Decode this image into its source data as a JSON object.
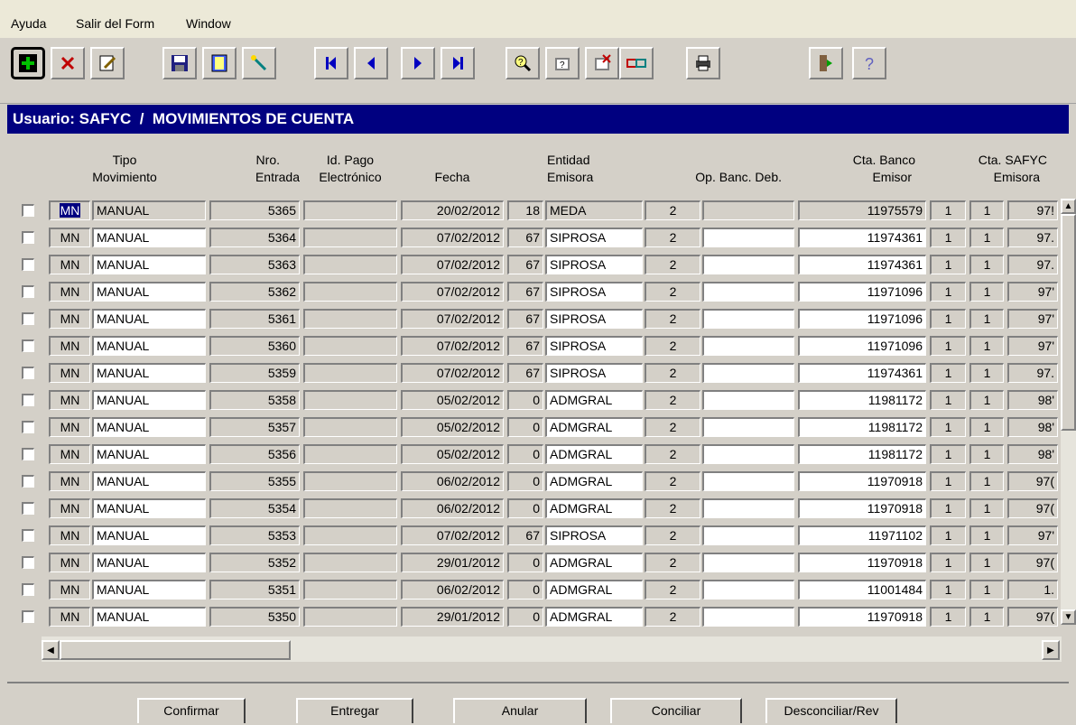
{
  "menu": {
    "items": [
      "Ayuda",
      "Salir del Form",
      "Window"
    ]
  },
  "toolbar": {
    "buttons": [
      "add-record-icon",
      "delete-record-icon",
      "edit-record-icon",
      "save-icon",
      "open-book-icon",
      "wand-icon",
      "first-record-icon",
      "previous-record-icon",
      "next-record-icon",
      "last-record-icon",
      "query-icon",
      "execute-query-icon",
      "cancel-query-icon",
      "link-icon",
      "print-icon",
      "exit-door-icon",
      "help-icon"
    ]
  },
  "header": {
    "title": "Usuario: SAFYC  /  MOVIMIENTOS DE CUENTA"
  },
  "columns": {
    "tipo": [
      "Tipo",
      "Movimiento"
    ],
    "nro": [
      "Nro.",
      "Entrada"
    ],
    "idpago": [
      "Id. Pago",
      "Electrónico"
    ],
    "fecha": "Fecha",
    "entidad": [
      "Entidad",
      "Emisora"
    ],
    "opbanc": "Op. Banc. Deb.",
    "ctabanco": [
      "Cta. Banco",
      "Emisor"
    ],
    "ctasafyc": [
      "Cta. SAFYC",
      "Emisora"
    ]
  },
  "rows": [
    {
      "code": "MN",
      "type": "MANUAL",
      "nro": "5365",
      "id_pago": "",
      "fecha": "20/02/2012",
      "ent_code": "18",
      "entidad": "MEDA",
      "op": "2",
      "op_deb": "",
      "cta_banco": "11975579",
      "s1": "1",
      "s2": "1",
      "s3": "97!"
    },
    {
      "code": "MN",
      "type": "MANUAL",
      "nro": "5364",
      "id_pago": "",
      "fecha": "07/02/2012",
      "ent_code": "67",
      "entidad": "SIPROSA",
      "op": "2",
      "op_deb": "",
      "cta_banco": "11974361",
      "s1": "1",
      "s2": "1",
      "s3": "97."
    },
    {
      "code": "MN",
      "type": "MANUAL",
      "nro": "5363",
      "id_pago": "",
      "fecha": "07/02/2012",
      "ent_code": "67",
      "entidad": "SIPROSA",
      "op": "2",
      "op_deb": "",
      "cta_banco": "11974361",
      "s1": "1",
      "s2": "1",
      "s3": "97."
    },
    {
      "code": "MN",
      "type": "MANUAL",
      "nro": "5362",
      "id_pago": "",
      "fecha": "07/02/2012",
      "ent_code": "67",
      "entidad": "SIPROSA",
      "op": "2",
      "op_deb": "",
      "cta_banco": "11971096",
      "s1": "1",
      "s2": "1",
      "s3": "97'"
    },
    {
      "code": "MN",
      "type": "MANUAL",
      "nro": "5361",
      "id_pago": "",
      "fecha": "07/02/2012",
      "ent_code": "67",
      "entidad": "SIPROSA",
      "op": "2",
      "op_deb": "",
      "cta_banco": "11971096",
      "s1": "1",
      "s2": "1",
      "s3": "97'"
    },
    {
      "code": "MN",
      "type": "MANUAL",
      "nro": "5360",
      "id_pago": "",
      "fecha": "07/02/2012",
      "ent_code": "67",
      "entidad": "SIPROSA",
      "op": "2",
      "op_deb": "",
      "cta_banco": "11971096",
      "s1": "1",
      "s2": "1",
      "s3": "97'"
    },
    {
      "code": "MN",
      "type": "MANUAL",
      "nro": "5359",
      "id_pago": "",
      "fecha": "07/02/2012",
      "ent_code": "67",
      "entidad": "SIPROSA",
      "op": "2",
      "op_deb": "",
      "cta_banco": "11974361",
      "s1": "1",
      "s2": "1",
      "s3": "97."
    },
    {
      "code": "MN",
      "type": "MANUAL",
      "nro": "5358",
      "id_pago": "",
      "fecha": "05/02/2012",
      "ent_code": "0",
      "entidad": "ADMGRAL",
      "op": "2",
      "op_deb": "",
      "cta_banco": "11981172",
      "s1": "1",
      "s2": "1",
      "s3": "98'"
    },
    {
      "code": "MN",
      "type": "MANUAL",
      "nro": "5357",
      "id_pago": "",
      "fecha": "05/02/2012",
      "ent_code": "0",
      "entidad": "ADMGRAL",
      "op": "2",
      "op_deb": "",
      "cta_banco": "11981172",
      "s1": "1",
      "s2": "1",
      "s3": "98'"
    },
    {
      "code": "MN",
      "type": "MANUAL",
      "nro": "5356",
      "id_pago": "",
      "fecha": "05/02/2012",
      "ent_code": "0",
      "entidad": "ADMGRAL",
      "op": "2",
      "op_deb": "",
      "cta_banco": "11981172",
      "s1": "1",
      "s2": "1",
      "s3": "98'"
    },
    {
      "code": "MN",
      "type": "MANUAL",
      "nro": "5355",
      "id_pago": "",
      "fecha": "06/02/2012",
      "ent_code": "0",
      "entidad": "ADMGRAL",
      "op": "2",
      "op_deb": "",
      "cta_banco": "11970918",
      "s1": "1",
      "s2": "1",
      "s3": "97("
    },
    {
      "code": "MN",
      "type": "MANUAL",
      "nro": "5354",
      "id_pago": "",
      "fecha": "06/02/2012",
      "ent_code": "0",
      "entidad": "ADMGRAL",
      "op": "2",
      "op_deb": "",
      "cta_banco": "11970918",
      "s1": "1",
      "s2": "1",
      "s3": "97("
    },
    {
      "code": "MN",
      "type": "MANUAL",
      "nro": "5353",
      "id_pago": "",
      "fecha": "07/02/2012",
      "ent_code": "67",
      "entidad": "SIPROSA",
      "op": "2",
      "op_deb": "",
      "cta_banco": "11971102",
      "s1": "1",
      "s2": "1",
      "s3": "97'"
    },
    {
      "code": "MN",
      "type": "MANUAL",
      "nro": "5352",
      "id_pago": "",
      "fecha": "29/01/2012",
      "ent_code": "0",
      "entidad": "ADMGRAL",
      "op": "2",
      "op_deb": "",
      "cta_banco": "11970918",
      "s1": "1",
      "s2": "1",
      "s3": "97("
    },
    {
      "code": "MN",
      "type": "MANUAL",
      "nro": "5351",
      "id_pago": "",
      "fecha": "06/02/2012",
      "ent_code": "0",
      "entidad": "ADMGRAL",
      "op": "2",
      "op_deb": "",
      "cta_banco": "11001484",
      "s1": "1",
      "s2": "1",
      "s3": "1."
    },
    {
      "code": "MN",
      "type": "MANUAL",
      "nro": "5350",
      "id_pago": "",
      "fecha": "29/01/2012",
      "ent_code": "0",
      "entidad": "ADMGRAL",
      "op": "2",
      "op_deb": "",
      "cta_banco": "11970918",
      "s1": "1",
      "s2": "1",
      "s3": "97("
    }
  ],
  "actions": {
    "confirmar": "Confirmar",
    "entregar": "Entregar",
    "anular": "Anular",
    "conciliar": "Conciliar",
    "desconciliar": "Desconciliar/Rev"
  }
}
